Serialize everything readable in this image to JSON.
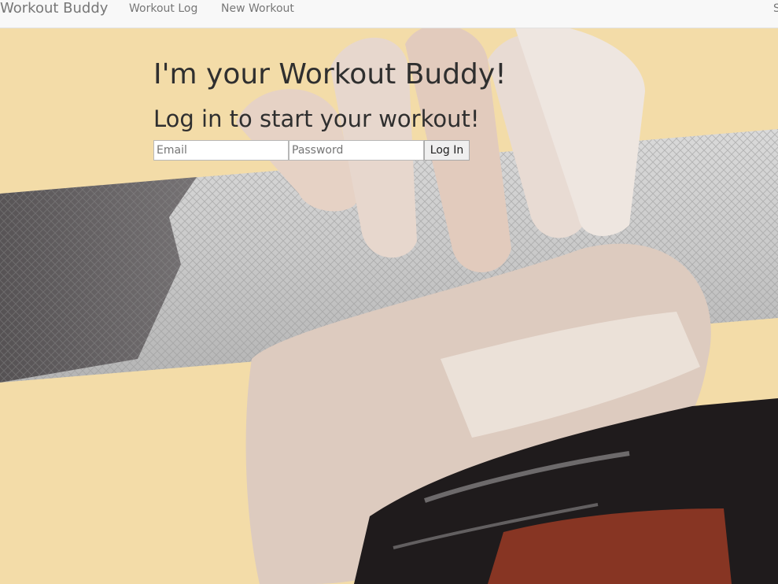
{
  "nav": {
    "brand": "Workout Buddy",
    "links": [
      "Workout Log",
      "New Workout"
    ],
    "right_cut": "S"
  },
  "hero": {
    "background_icon": "hand-gripping-barbell-photo",
    "title": "I'm your Workout Buddy!",
    "subtitle": "Log in to start your workout!"
  },
  "login": {
    "email_placeholder": "Email",
    "password_placeholder": "Password",
    "submit_label": "Log In"
  },
  "colors": {
    "background": "#f3dca8",
    "text": "#2f2f2f",
    "nav_bg": "#f8f8f8",
    "nav_text": "#777777"
  }
}
